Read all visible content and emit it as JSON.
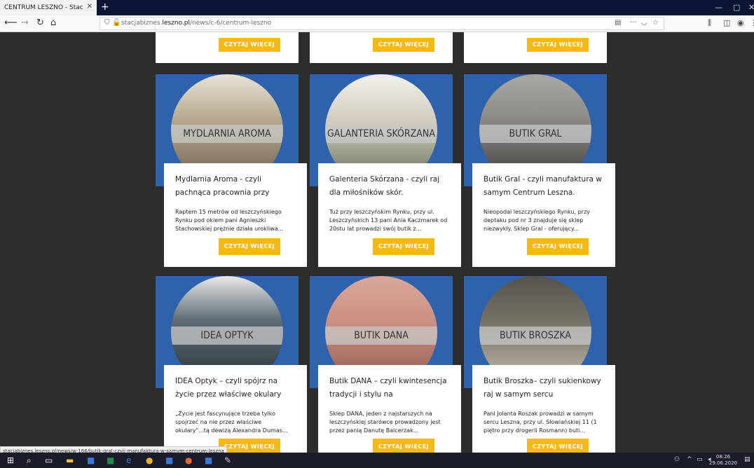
{
  "browser": {
    "tab_title": "CENTRUM LESZNO - Stacja Biznes",
    "tab_close": "✕",
    "new_tab": "+",
    "url_prefix": "stacjabiznes.",
    "url_domain": "leszno.pl",
    "url_path": "/news/c-6/centrum-leszno",
    "status_url": "stacjabiznes.leszno.pl/news/w-166/butik-gral-czyli-manufaktura-w-samym-centrum-leszna"
  },
  "top_buttons": [
    "CZYTAJ WIĘCEJ",
    "CZYTAJ WIĘCEJ",
    "CZYTAJ WIĘCEJ"
  ],
  "cards": [
    {
      "image_label": "MYDLARNIA AROMA",
      "title": "Mydlarnia Aroma - czyli pachnąca pracownia przy",
      "text": "Raptem 15 metrów od leszczyńskiego Rynku pod okiem pani Agnieszki Stachowskiej prężnie działa urokliwa...",
      "button": "CZYTAJ WIĘCEJ",
      "photo_color": "#b7a98f"
    },
    {
      "image_label": "GALANTERIA SKÓRZANA",
      "title": "Galenteria Skórzana - czyli raj dla miłośników skór.",
      "text": "Tuż przy leszczyńskim Rynku, przy ul. Leszczyńskich 13 pani Ania Kaczmarek od 20stu lat prowadzi swój butik z...",
      "button": "CZYTAJ WIĘCEJ",
      "photo_color": "#cfc9bd"
    },
    {
      "image_label": "BUTIK GRAL",
      "title": "Butik Gral - czyli manufaktura w samym Centrum Leszna.",
      "text": "Nieopodal leszczyńskiego Rynku, przy deptaku pod nr 3 znajduje się sklep niezwykły. Sklep Gral - oferujący...",
      "button": "CZYTAJ WIĘCEJ",
      "photo_color": "#8d8a86"
    },
    {
      "image_label": "IDEA OPTYK",
      "title": "IDEA Optyk – czyli spójrz na życie przez właściwe okulary",
      "text": "„Życie jest fascynujące trzeba tylko spojrzeć na nie przez właściwe okulary\"...tą dewizą Alexandra Dumas...",
      "button": "CZYTAJ WIĘCEJ",
      "photo_color": "#5d6a73"
    },
    {
      "image_label": "BUTIK DANA",
      "title": "Butik DANA – czyli kwintesencja tradycji i stylu na",
      "text": "Sklep DANA, jeden z najstarszych na leszczyńskiej starówce prowadzony jest przez panią Danutę Balcerzak...",
      "button": "CZYTAJ WIĘCEJ",
      "photo_color": "#c98d7f"
    },
    {
      "image_label": "BUTIK BROSZKA",
      "title": "Butik Broszka– czyli sukienkowy raj w samym sercu",
      "text": "Pani Jolanta Roszak prowadzi w samym sercu Leszna, przy ul. Słowiańskiej 11 (1 piętro przy drogerii Rosmann) buti...",
      "button": "CZYTAJ WIĘCEJ",
      "photo_color": "#7f7a6e"
    }
  ],
  "taskbar": {
    "time": "08:26",
    "date": "29.06.2020"
  },
  "colors": {
    "accent": "#f5b914",
    "card_blue": "#2e62ad",
    "page_bg": "#2d2d2d"
  }
}
